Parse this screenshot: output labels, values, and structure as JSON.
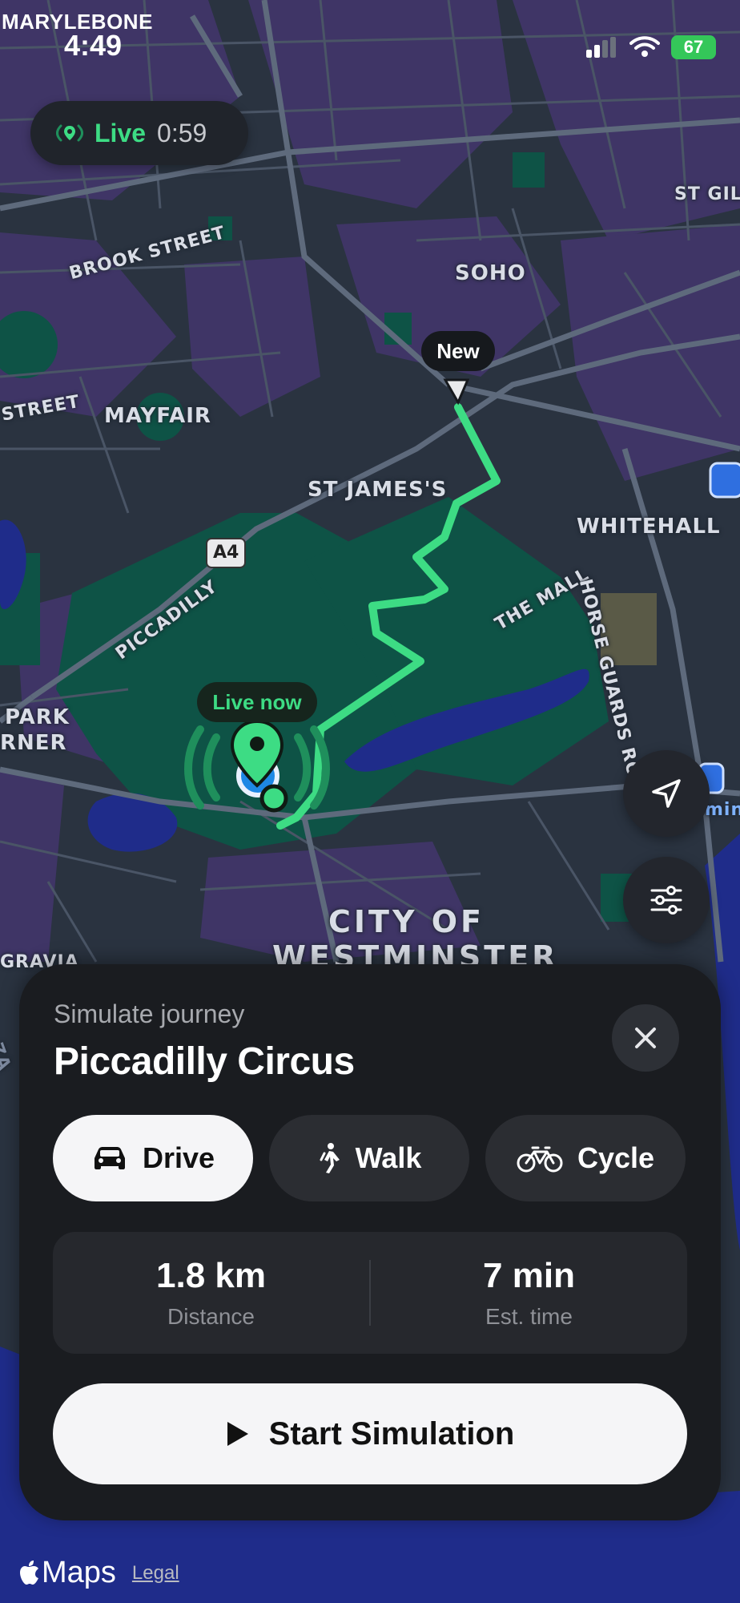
{
  "status_bar": {
    "area": "MARYLEBONE",
    "time": "4:49",
    "battery": "67"
  },
  "live_pill": {
    "label": "Live",
    "timer": "0:59"
  },
  "map": {
    "labels": {
      "soho": "SOHO",
      "st_giles": "ST GILE",
      "brook_street": "BROOK STREET",
      "street_left": "STREET",
      "mayfair": "MAYFAIR",
      "st_james": "ST JAMES'S",
      "whitehall": "WHITEHALL",
      "a4": "A4",
      "piccadilly": "PICCADILLY",
      "the_mall": "THE MALL",
      "horse_guards": "HORSE GUARDS ROAD",
      "park": "PARK",
      "rner": "RNER",
      "city_of": "CITY OF",
      "westminster": "WESTMINSTER",
      "gravia": "GRAVIA",
      "mins": "mins",
      "unpaved_road": "ZA"
    },
    "pins": {
      "destination": "New",
      "current": "Live now"
    }
  },
  "sheet": {
    "subtitle": "Simulate journey",
    "title": "Piccadilly Circus",
    "modes": [
      {
        "label": "Drive",
        "icon": "car-icon",
        "active": true
      },
      {
        "label": "Walk",
        "icon": "walk-icon",
        "active": false
      },
      {
        "label": "Cycle",
        "icon": "bicycle-icon",
        "active": false
      }
    ],
    "stats": {
      "distance_value": "1.8 km",
      "distance_caption": "Distance",
      "time_value": "7 min",
      "time_caption": "Est. time"
    },
    "start_label": "Start Simulation"
  },
  "footer": {
    "maps": "Maps",
    "legal": "Legal"
  },
  "colors": {
    "route": "#3ddc84",
    "accent_blue": "#1e88e5",
    "park": "#0e5a4a",
    "water": "#1f2c8a"
  }
}
